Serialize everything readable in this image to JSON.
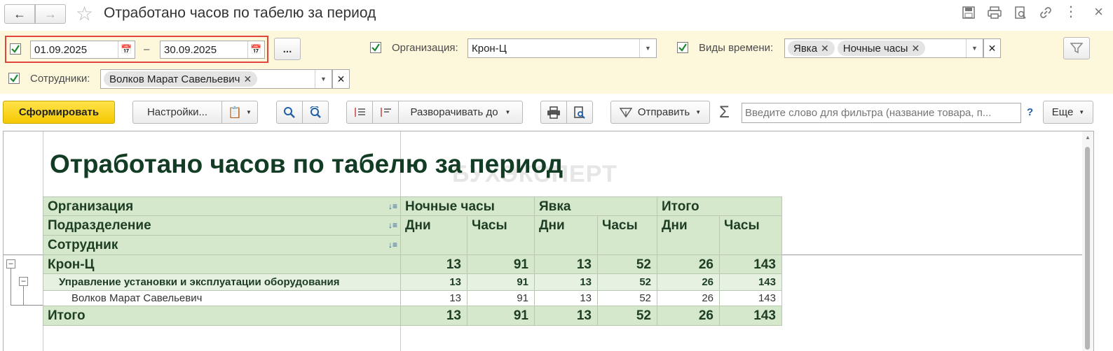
{
  "window": {
    "title": "Отработано часов по табелю за период"
  },
  "filters": {
    "period_from": "01.09.2025",
    "period_dash": "–",
    "period_to": "30.09.2025",
    "period_more": "...",
    "org_label": "Организация:",
    "org_value": "Крон-Ц",
    "time_types_label": "Виды времени:",
    "time_types": [
      "Явка",
      "Ночные часы"
    ],
    "employees_label": "Сотрудники:",
    "employees": [
      "Волков Марат Савельевич"
    ]
  },
  "toolbar": {
    "generate": "Сформировать",
    "settings": "Настройки...",
    "expand_to": "Разворачивать до",
    "send": "Отправить",
    "sum_symbol": "Σ",
    "search_placeholder": "Введите слово для фильтра (название товара, п...",
    "help": "?",
    "more": "Еще"
  },
  "report": {
    "title": "Отработано часов по табелю за период",
    "watermark": "БУХЭКСПЕРТ",
    "row_headers": [
      "Организация",
      "Подразделение",
      "Сотрудник"
    ],
    "groups": [
      "Ночные часы",
      "Явка",
      "Итого"
    ],
    "sub_headers": [
      "Дни",
      "Часы",
      "Дни",
      "Часы",
      "Дни",
      "Часы"
    ],
    "rows": [
      {
        "label": "Крон-Ц",
        "values": [
          "13",
          "91",
          "13",
          "52",
          "26",
          "143"
        ]
      },
      {
        "label": "Управление установки и эксплуатации оборудования",
        "values": [
          "13",
          "91",
          "13",
          "52",
          "26",
          "143"
        ]
      },
      {
        "label": "Волков Марат Савельевич",
        "values": [
          "13",
          "91",
          "13",
          "52",
          "26",
          "143"
        ]
      },
      {
        "label": "Итого",
        "values": [
          "13",
          "91",
          "13",
          "52",
          "26",
          "143"
        ]
      }
    ]
  },
  "colors": {
    "accent_yellow": "#f5d000",
    "filter_bg": "#fdf8dc",
    "report_header_bg": "#d6e8cc",
    "highlight_border": "#e0463a"
  }
}
